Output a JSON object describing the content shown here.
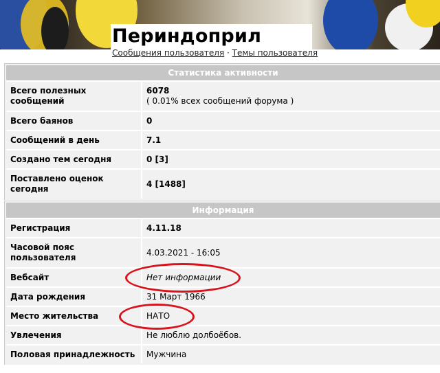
{
  "header": {
    "title": "Периндоприл",
    "links": [
      "Сообщения пользователя",
      "Темы пользователя"
    ],
    "separator": "·"
  },
  "stats": {
    "heading": "Статистика активности",
    "rows": [
      {
        "label": "Всего полезных сообщений",
        "value": "6078",
        "note": "( 0.01% всех сообщений форума )"
      },
      {
        "label": "Всего баянов",
        "value": "0"
      },
      {
        "label": "Сообщений в день",
        "value": "7.1"
      },
      {
        "label": "Создано тем сегодня",
        "value": "0 [3]"
      },
      {
        "label": "Поставлено оценок сегодня",
        "value": "4 [1488]"
      }
    ]
  },
  "info": {
    "heading": "Информация",
    "rows": [
      {
        "label": "Регистрация",
        "value": "4.11.18"
      },
      {
        "label": "Часовой пояс пользователя",
        "value": "4.03.2021 - 16:05"
      },
      {
        "label": "Вебсайт",
        "value": "Нет информации"
      },
      {
        "label": "Дата рождения",
        "value": "31 Март 1966"
      },
      {
        "label": "Место жительства",
        "value": "НАТО"
      },
      {
        "label": "Увлечения",
        "value": "Не люблю долбоёбов."
      },
      {
        "label": "Половая принадлежность",
        "value": "Мужчина"
      }
    ]
  },
  "annotation_color": "#d7141e"
}
